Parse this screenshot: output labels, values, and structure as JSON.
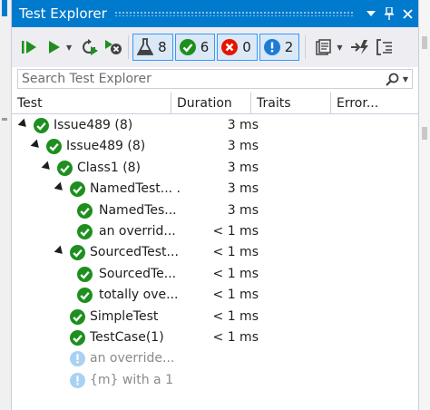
{
  "window": {
    "title": "Test Explorer",
    "dropdown_icon": "chevron-down-icon",
    "pin_icon": "pin-icon",
    "close_icon": "close-icon"
  },
  "toolbar": {
    "counts": {
      "total": "8",
      "passed": "6",
      "failed": "0",
      "not_run": "2"
    }
  },
  "search": {
    "placeholder": "Search Test Explorer",
    "value": ""
  },
  "columns": {
    "test": "Test",
    "duration": "Duration",
    "traits": "Traits",
    "error": "Error..."
  },
  "tree": [
    {
      "name": "Issue489  (8)",
      "duration": "3 ms",
      "status": "passed",
      "level": 0,
      "expanded": true
    },
    {
      "name": "Issue489  (8)",
      "duration": "3 ms",
      "status": "passed",
      "level": 1,
      "expanded": true
    },
    {
      "name": "Class1  (8)",
      "duration": "3 ms",
      "status": "passed",
      "level": 2,
      "expanded": true
    },
    {
      "name": "NamedTest... .",
      "duration": "3 ms",
      "status": "passed",
      "level": 3,
      "expanded": true
    },
    {
      "name": "NamedTes...",
      "duration": "3 ms",
      "status": "passed",
      "level": 4,
      "expanded": false
    },
    {
      "name": "an overrid...",
      "duration": "< 1 ms",
      "status": "passed",
      "level": 4,
      "expanded": false
    },
    {
      "name": "SourcedTest...",
      "duration": "< 1 ms",
      "status": "passed",
      "level": 3,
      "expanded": true
    },
    {
      "name": "SourcedTe...",
      "duration": "< 1 ms",
      "status": "passed",
      "level": 4,
      "expanded": false
    },
    {
      "name": "totally ove...",
      "duration": "< 1 ms",
      "status": "passed",
      "level": 4,
      "expanded": false
    },
    {
      "name": "SimpleTest",
      "duration": "< 1 ms",
      "status": "passed",
      "level": 3,
      "expanded": false
    },
    {
      "name": "TestCase(1)",
      "duration": "< 1 ms",
      "status": "passed",
      "level": 3,
      "expanded": false
    },
    {
      "name": "an override...",
      "duration": "",
      "status": "not_run",
      "level": 3,
      "expanded": false
    },
    {
      "name": "{m} with a 1",
      "duration": "",
      "status": "not_run",
      "level": 3,
      "expanded": false
    }
  ],
  "colors": {
    "accent": "#007acc",
    "passed": "#1e8f1e",
    "failed": "#e51400",
    "info": "#1e7bd6",
    "not_run": "#a9d1f2"
  }
}
